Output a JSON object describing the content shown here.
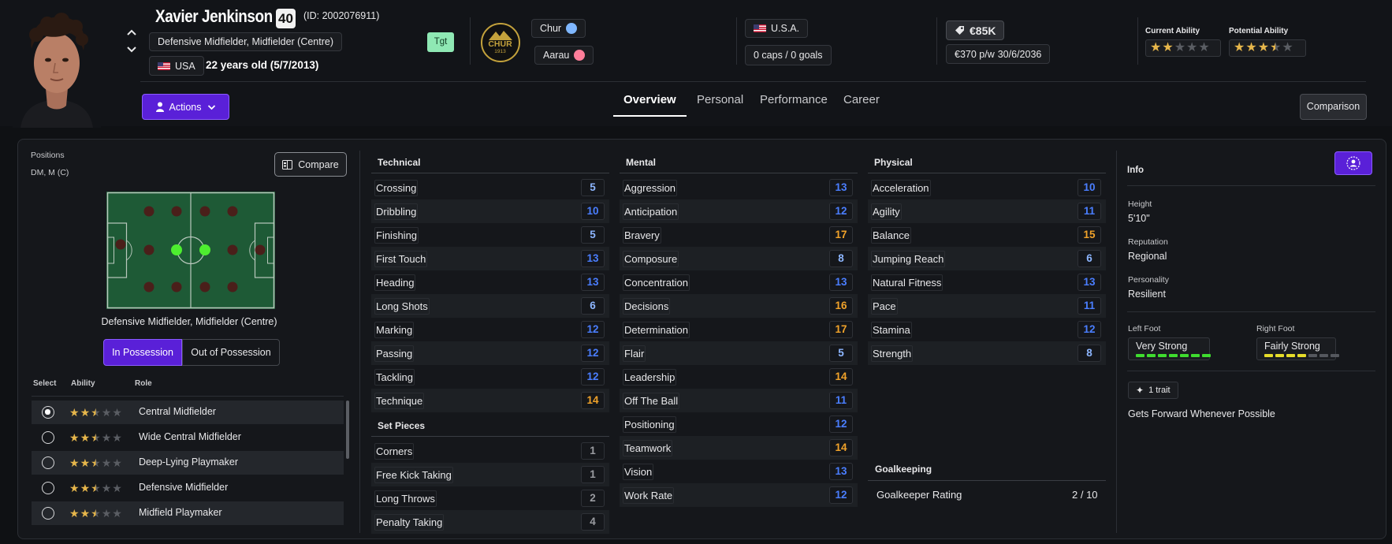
{
  "player": {
    "name": "Xavier Jenkinson",
    "age_badge": "40",
    "id": "(ID: 2002076911)",
    "positions": "Defensive Midfielder, Midfielder (Centre)",
    "nationality": "USA",
    "age_text": "22 years old (5/7/2013)",
    "tag": "Tgt"
  },
  "club": {
    "crest_text": "CHUR",
    "crest_year": "1913",
    "parent_club": "Chur",
    "loan_club": "Aarau"
  },
  "international": {
    "nation": "U.S.A.",
    "caps": "0 caps / 0 goals"
  },
  "contract": {
    "value": "€85K",
    "wage": "€370 p/w",
    "expiry": "30/6/2036"
  },
  "ability": {
    "current_label": "Current Ability",
    "potential_label": "Potential Ability",
    "current_stars": 2,
    "potential_stars": 3.5
  },
  "actions_label": "Actions",
  "tabs": [
    "Overview",
    "Personal",
    "Performance",
    "Career"
  ],
  "comparison_label": "Comparison",
  "positions_panel": {
    "title": "Positions",
    "short": "DM, M (C)",
    "compare_label": "Compare",
    "pitch_caption": "Defensive Midfielder, Midfielder (Centre)",
    "possession_tabs": [
      "In Possession",
      "Out of Possession"
    ],
    "columns": [
      "Select",
      "Ability",
      "Role"
    ],
    "roles": [
      {
        "name": "Central Midfielder",
        "stars": 2.5,
        "selected": true
      },
      {
        "name": "Wide Central Midfielder",
        "stars": 2.5,
        "selected": false
      },
      {
        "name": "Deep-Lying Playmaker",
        "stars": 2.5,
        "selected": false
      },
      {
        "name": "Defensive Midfielder",
        "stars": 2.5,
        "selected": false
      },
      {
        "name": "Midfield Playmaker",
        "stars": 2.5,
        "selected": false
      }
    ]
  },
  "technical": {
    "title": "Technical",
    "attrs": [
      {
        "name": "Crossing",
        "value": "5"
      },
      {
        "name": "Dribbling",
        "value": "10"
      },
      {
        "name": "Finishing",
        "value": "5"
      },
      {
        "name": "First Touch",
        "value": "13"
      },
      {
        "name": "Heading",
        "value": "13"
      },
      {
        "name": "Long Shots",
        "value": "6"
      },
      {
        "name": "Marking",
        "value": "12"
      },
      {
        "name": "Passing",
        "value": "12"
      },
      {
        "name": "Tackling",
        "value": "12"
      },
      {
        "name": "Technique",
        "value": "14"
      }
    ]
  },
  "set_pieces": {
    "title": "Set Pieces",
    "attrs": [
      {
        "name": "Corners",
        "value": "1"
      },
      {
        "name": "Free Kick Taking",
        "value": "1"
      },
      {
        "name": "Long Throws",
        "value": "2"
      },
      {
        "name": "Penalty Taking",
        "value": "4"
      }
    ]
  },
  "mental": {
    "title": "Mental",
    "attrs": [
      {
        "name": "Aggression",
        "value": "13"
      },
      {
        "name": "Anticipation",
        "value": "12"
      },
      {
        "name": "Bravery",
        "value": "17"
      },
      {
        "name": "Composure",
        "value": "8"
      },
      {
        "name": "Concentration",
        "value": "13"
      },
      {
        "name": "Decisions",
        "value": "16"
      },
      {
        "name": "Determination",
        "value": "17"
      },
      {
        "name": "Flair",
        "value": "5"
      },
      {
        "name": "Leadership",
        "value": "14"
      },
      {
        "name": "Off The Ball",
        "value": "11"
      },
      {
        "name": "Positioning",
        "value": "12"
      },
      {
        "name": "Teamwork",
        "value": "14"
      },
      {
        "name": "Vision",
        "value": "13"
      },
      {
        "name": "Work Rate",
        "value": "12"
      }
    ]
  },
  "physical": {
    "title": "Physical",
    "attrs": [
      {
        "name": "Acceleration",
        "value": "10"
      },
      {
        "name": "Agility",
        "value": "11"
      },
      {
        "name": "Balance",
        "value": "15"
      },
      {
        "name": "Jumping Reach",
        "value": "6"
      },
      {
        "name": "Natural Fitness",
        "value": "13"
      },
      {
        "name": "Pace",
        "value": "11"
      },
      {
        "name": "Stamina",
        "value": "12"
      },
      {
        "name": "Strength",
        "value": "8"
      }
    ]
  },
  "goalkeeping": {
    "title": "Goalkeeping",
    "rating_label": "Goalkeeper Rating",
    "rating_value": "2 / 10"
  },
  "info": {
    "title": "Info",
    "height_label": "Height",
    "height": "5'10\"",
    "reputation_label": "Reputation",
    "reputation": "Regional",
    "personality_label": "Personality",
    "personality": "Resilient",
    "left_foot_label": "Left Foot",
    "left_foot": "Very Strong",
    "left_foot_level": 6,
    "right_foot_label": "Right Foot",
    "right_foot": "Fairly Strong",
    "right_foot_level": 4,
    "traits_count": "1 trait",
    "trait": "Gets Forward Whenever Possible"
  },
  "colors": {
    "accent": "#5a20d8",
    "high_value": "#f0a22a",
    "mid_value": "#4a7eff",
    "low_value": "#8db6ff",
    "pitch": "#1e5a36"
  }
}
